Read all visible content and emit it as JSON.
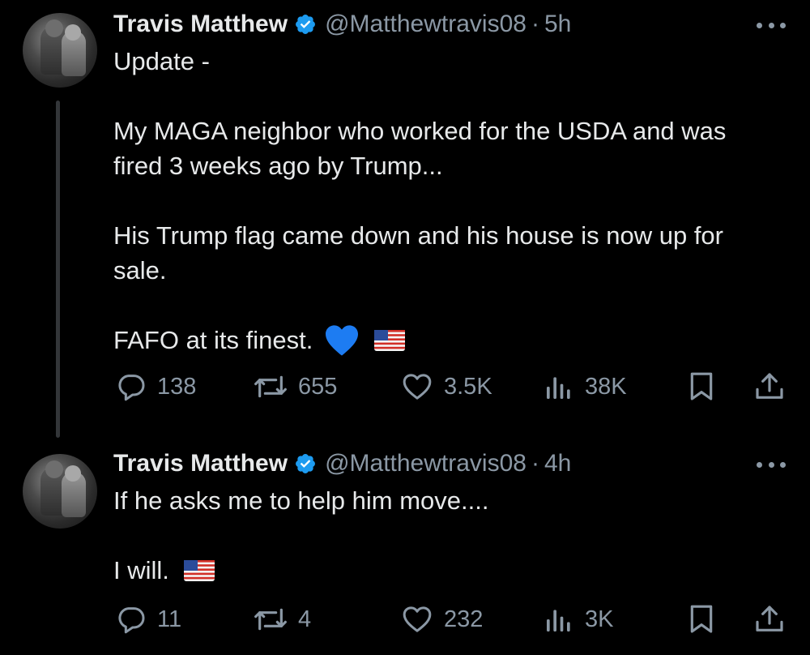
{
  "tweets": [
    {
      "author": "Travis Matthew",
      "handle": "@Matthewtravis08",
      "separator": "·",
      "time": "5h",
      "lines": [
        "Update -",
        "",
        "My MAGA neighbor who worked for the USDA and was",
        "fired 3 weeks ago by Trump...",
        "",
        "His Trump flag came down and his house is now up for",
        "sale.",
        "",
        "FAFO at its finest."
      ],
      "emojis": [
        "blue-heart",
        "us-flag"
      ],
      "replies": "138",
      "reposts": "655",
      "likes": "3.5K",
      "views": "38K"
    },
    {
      "author": "Travis Matthew",
      "handle": "@Matthewtravis08",
      "separator": "·",
      "time": "4h",
      "lines": [
        "If he asks me to help him move....",
        "",
        "I will."
      ],
      "emojis": [
        "us-flag"
      ],
      "replies": "11",
      "reposts": "4",
      "likes": "232",
      "views": "3K"
    }
  ],
  "colors": {
    "background": "#000000",
    "text": "#e7e9ea",
    "muted": "#8b98a5",
    "verified": "#1d9bf0",
    "thread_line": "#333639"
  },
  "icons": [
    "verified-badge-icon",
    "more-icon",
    "reply-icon",
    "repost-icon",
    "like-icon",
    "views-icon",
    "bookmark-icon",
    "share-icon"
  ]
}
